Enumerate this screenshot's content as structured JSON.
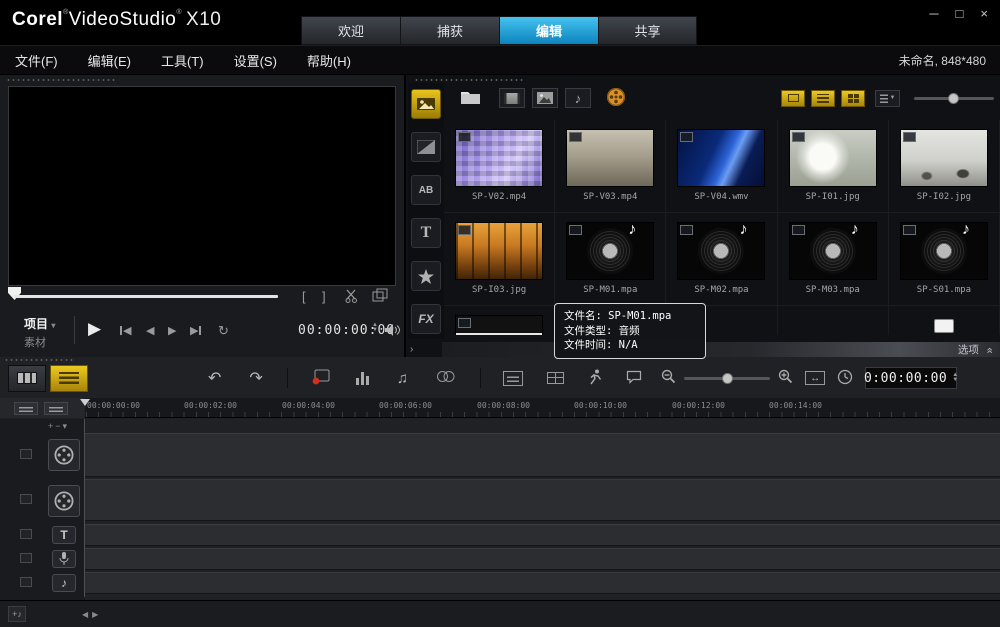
{
  "titlebar": {
    "brand": {
      "corel": "Corel",
      "product": "VideoStudio",
      "version": "X10",
      "reg": "®"
    },
    "tabs": [
      {
        "label": "欢迎"
      },
      {
        "label": "捕获"
      },
      {
        "label": "编辑"
      },
      {
        "label": "共享"
      }
    ],
    "window_controls": {
      "minimize": "─",
      "maximize": "□",
      "close": "×"
    }
  },
  "menubar": {
    "items": [
      {
        "label": "文件(F)"
      },
      {
        "label": "编辑(E)"
      },
      {
        "label": "工具(T)"
      },
      {
        "label": "设置(S)"
      },
      {
        "label": "帮助(H)"
      }
    ],
    "project_info": "未命名, 848*480"
  },
  "preview": {
    "mode_primary": "项目",
    "mode_secondary": "素材",
    "timecode": "00:00:00:00"
  },
  "library": {
    "items": [
      {
        "name": "SP-V02.mp4"
      },
      {
        "name": "SP-V03.mp4"
      },
      {
        "name": "SP-V04.wmv"
      },
      {
        "name": "SP-I01.jpg"
      },
      {
        "name": "SP-I02.jpg"
      },
      {
        "name": "SP-I03.jpg"
      },
      {
        "name": "SP-M01.mpa"
      },
      {
        "name": "SP-M02.mpa"
      },
      {
        "name": "SP-M03.mpa"
      },
      {
        "name": "SP-S01.mpa"
      }
    ],
    "tooltip": {
      "filename": "文件名: SP-M01.mpa",
      "filetype": "文件类型: 音频",
      "filetime": "文件时间: N/A"
    },
    "options_label": "选项",
    "sidebar": {
      "ab": "AB",
      "t": "T",
      "fx": "FX"
    }
  },
  "timeline": {
    "timecode": "0:00:00:00",
    "ruler_labels": [
      "00:00:00:00",
      "00:00:02:00",
      "00:00:04:00",
      "00:00:06:00",
      "00:00:08:00",
      "00:00:10:00",
      "00:00:12:00",
      "00:00:14:00"
    ],
    "track_title_label": "T"
  },
  "icons": {
    "play": "▶",
    "tri_left": "◀",
    "tri_right": "▶",
    "loop": "↻",
    "undo": "↶",
    "redo": "↷",
    "note": "♪",
    "notes": "♫",
    "up": "▲",
    "down": "▼",
    "mark_in": "[",
    "mark_out": "]",
    "chevrons_up": "«",
    "expand": "›",
    "fit": "↔",
    "plus": "+",
    "minus": "−",
    "drop": "▾"
  },
  "colors": {
    "accent_yellow": "#d9b300",
    "accent_blue": "#1f9ad6"
  }
}
